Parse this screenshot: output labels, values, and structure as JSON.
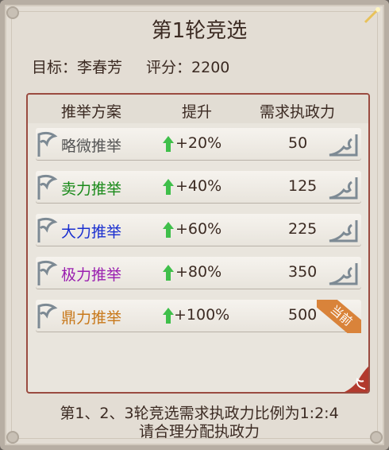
{
  "title": "第1轮竞选",
  "info": {
    "target_label": "目标：",
    "target_name": "李春芳",
    "score_label": "评分：",
    "score_value": "2200"
  },
  "table": {
    "headers": [
      "推举方案",
      "提升",
      "需求执政力"
    ],
    "rows": [
      {
        "name": "略微推举",
        "boost": "+20%",
        "cost": "50",
        "color": "#555555"
      },
      {
        "name": "卖力推举",
        "boost": "+40%",
        "cost": "125",
        "color": "#1a8a1a"
      },
      {
        "name": "大力推举",
        "boost": "+60%",
        "cost": "225",
        "color": "#1a2fd0"
      },
      {
        "name": "极力推举",
        "boost": "+80%",
        "cost": "350",
        "color": "#9a1fb0"
      },
      {
        "name": "鼎力推举",
        "boost": "+100%",
        "cost": "500",
        "color": "#c8781a"
      }
    ],
    "current_badge": "当前"
  },
  "footer": {
    "line1": "第1、2、3轮竞选需求执政力比例为1:2:4",
    "line2": "请合理分配执政力"
  },
  "colors": {
    "accent_red": "#9a4b40",
    "arrow_green": "#3fbf4a",
    "badge_orange": "#d9833a"
  }
}
